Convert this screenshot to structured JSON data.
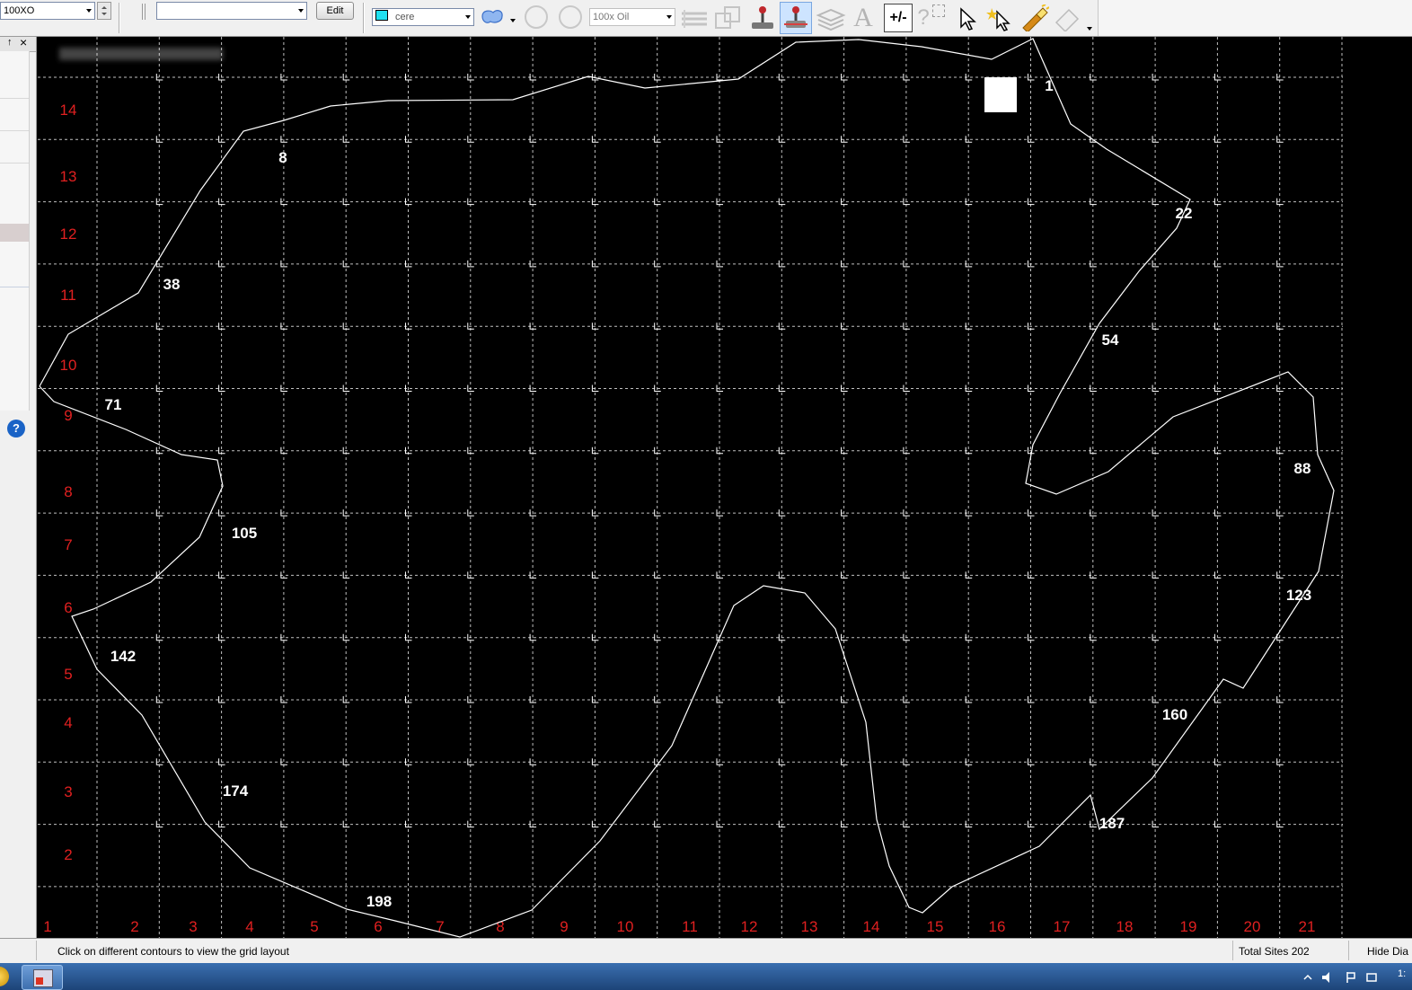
{
  "toolbar": {
    "combo_left_value": "100XO",
    "combo_middle_value": "",
    "edit_label": "Edit",
    "color_combo_value": "cere",
    "color_swatch": "#20e0f0",
    "objective_combo_value": "100x Oil",
    "text_tool_glyph": "A",
    "plusminus_glyph": "+/-",
    "help_glyph": "?",
    "icons": [
      "blob-shape-icon",
      "circle-shape-icon",
      "circle-shape-alt-icon",
      "layers-stack-icon",
      "grid-select-icon",
      "joystick-icon",
      "stage-icon",
      "layers-icon",
      "text-icon",
      "plus-minus-icon",
      "help-icon",
      "selection-marquee-icon",
      "pointer-icon",
      "magic-pointer-icon",
      "flashlight-icon",
      "eraser-icon"
    ]
  },
  "left_panel": {
    "pin_glyph": "↑",
    "close_glyph": "×",
    "help_glyph": "?"
  },
  "canvas": {
    "title_blurred": "",
    "row_labels": [
      "14",
      "13",
      "12",
      "11",
      "10",
      "9",
      "8",
      "7",
      "6",
      "5",
      "4",
      "3",
      "2"
    ],
    "col_labels": [
      "1",
      "2",
      "3",
      "4",
      "5",
      "6",
      "7",
      "8",
      "9",
      "10",
      "11",
      "12",
      "13",
      "14",
      "15",
      "16",
      "17",
      "18",
      "19",
      "20",
      "21"
    ],
    "site_labels": [
      "1",
      "8",
      "22",
      "38",
      "54",
      "71",
      "88",
      "105",
      "123",
      "142",
      "160",
      "174",
      "187",
      "198"
    ],
    "label_color_rows_cols": "#e02020",
    "contour_color": "#ffffff",
    "grid_color": "#ffffff"
  },
  "status": {
    "hint": "Click on different contours to view the grid layout",
    "total_sites": "Total Sites 202",
    "hide_label": "Hide Dia"
  },
  "taskbar": {
    "clock": "1:"
  }
}
